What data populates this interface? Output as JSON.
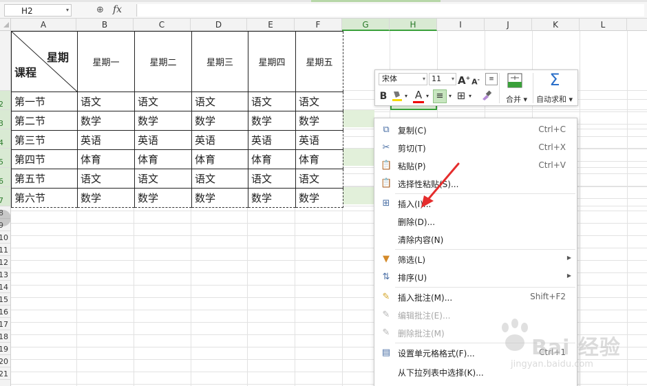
{
  "formula_bar": {
    "cell_ref": "H2",
    "fx": "fx",
    "value": ""
  },
  "columns": [
    "A",
    "B",
    "C",
    "D",
    "E",
    "F",
    "G",
    "H",
    "I",
    "J",
    "K",
    "L"
  ],
  "rows": [
    "",
    "2",
    "3",
    "4",
    "5",
    "6",
    "7",
    "8",
    "9",
    "10",
    "11",
    "12",
    "13",
    "14",
    "15",
    "16",
    "17",
    "18",
    "19",
    "20",
    "21"
  ],
  "table": {
    "diag_top": "星期",
    "diag_bottom": "课程",
    "headers": [
      "星期一",
      "星期二",
      "星期三",
      "星期四",
      "星期五"
    ],
    "body": [
      [
        "第一节",
        "语文",
        "语文",
        "语文",
        "语文",
        "语文"
      ],
      [
        "第二节",
        "数学",
        "数学",
        "数学",
        "数学",
        "数学"
      ],
      [
        "第三节",
        "英语",
        "英语",
        "英语",
        "英语",
        "英语"
      ],
      [
        "第四节",
        "体育",
        "体育",
        "体育",
        "体育",
        "体育"
      ],
      [
        "第五节",
        "语文",
        "语文",
        "语文",
        "语文",
        "语文"
      ],
      [
        "第六节",
        "数学",
        "数学",
        "数学",
        "数学",
        "数学"
      ]
    ]
  },
  "mini_toolbar": {
    "font": "宋体",
    "size": "11",
    "grow_font": "A",
    "shrink_font": "A",
    "bold": "B",
    "font_color": "A",
    "merge_label": "合并",
    "autosum_label": "自动求和",
    "autosum_glyph": "Σ"
  },
  "context_menu": [
    {
      "label": "复制(C)",
      "shortcut": "Ctrl+C",
      "icon": "copy-icon",
      "glyph": "⧉"
    },
    {
      "label": "剪切(T)",
      "shortcut": "Ctrl+X",
      "icon": "scissors-icon",
      "glyph": "✂"
    },
    {
      "label": "粘贴(P)",
      "shortcut": "Ctrl+V",
      "icon": "paste-icon",
      "glyph": "📋"
    },
    {
      "label": "选择性粘贴(S)...",
      "shortcut": "",
      "icon": "paste-special-icon",
      "glyph": "📋"
    },
    {
      "label": "插入(I)...",
      "shortcut": "",
      "icon": "insert-icon",
      "glyph": "⊞"
    },
    {
      "label": "删除(D)...",
      "shortcut": "",
      "icon": "",
      "glyph": ""
    },
    {
      "label": "清除内容(N)",
      "shortcut": "",
      "icon": "",
      "glyph": ""
    },
    {
      "label": "筛选(L)",
      "shortcut": "",
      "icon": "filter-icon",
      "glyph": "▼"
    },
    {
      "label": "排序(U)",
      "shortcut": "",
      "icon": "sort-icon",
      "glyph": "⇅"
    },
    {
      "label": "插入批注(M)...",
      "shortcut": "Shift+F2",
      "icon": "insert-comment-icon",
      "glyph": "✎"
    },
    {
      "label": "编辑批注(E)...",
      "shortcut": "",
      "icon": "edit-comment-icon",
      "glyph": "✎"
    },
    {
      "label": "删除批注(M)",
      "shortcut": "",
      "icon": "delete-comment-icon",
      "glyph": "✎"
    },
    {
      "label": "设置单元格格式(F)...",
      "shortcut": "Ctrl+1",
      "icon": "format-cells-icon",
      "glyph": "▤"
    },
    {
      "label": "从下拉列表中选择(K)...",
      "shortcut": "",
      "icon": "",
      "glyph": ""
    }
  ],
  "watermark": {
    "text": "Bai 经验",
    "sub": "jingyan.baidu.com"
  },
  "colors": {
    "accent": "#3aa03a",
    "selection": "#d9ead3",
    "arrow": "#e52d2d"
  }
}
